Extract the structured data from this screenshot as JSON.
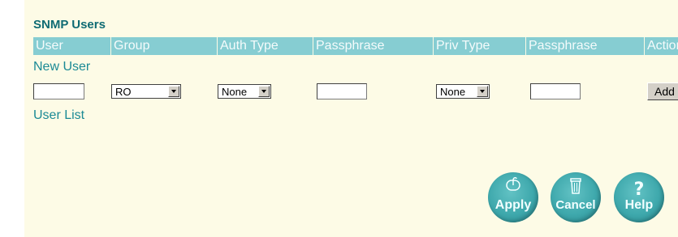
{
  "title": "SNMP Users",
  "columns": [
    "User",
    "Group",
    "Auth Type",
    "Passphrase",
    "Priv Type",
    "Passphrase",
    "Action"
  ],
  "new_user": {
    "label": "New User",
    "user_value": "",
    "group_value": "RO",
    "auth_type_value": "None",
    "auth_passphrase_value": "",
    "priv_type_value": "None",
    "priv_passphrase_value": "",
    "add_label": "Add"
  },
  "user_list": {
    "label": "User List"
  },
  "buttons": {
    "apply": "Apply",
    "cancel": "Cancel",
    "help": "Help"
  },
  "icons": {
    "apply": "mouse-icon",
    "cancel": "trash-icon",
    "help": "question-icon"
  },
  "colors": {
    "panel_bg": "#fdfbe6",
    "header_bg": "#86cdd2",
    "accent": "#1b8a95",
    "title": "#0f6b73"
  }
}
